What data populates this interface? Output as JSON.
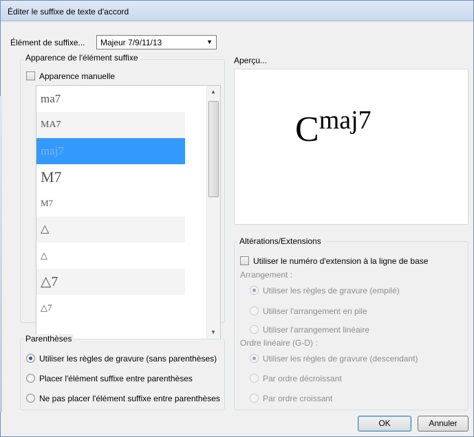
{
  "window": {
    "title": "Éditer le suffixe de texte d'accord"
  },
  "suffix_element": {
    "label": "Élément de suffixe...",
    "selected": "Majeur 7/9/11/13"
  },
  "appearance": {
    "group_title": "Apparence de l'élément suffixe",
    "manual_label": "Apparence manuelle",
    "manual_checked": false,
    "items": [
      "ma7",
      "MA7",
      "maj7",
      "M7",
      "M7",
      "△",
      "△",
      "△7",
      "△7"
    ],
    "selected_index": 2
  },
  "preview": {
    "title": "Aperçu...",
    "root": "C",
    "suffix": "maj7"
  },
  "parentheses": {
    "group_title": "Parenthèses",
    "options": [
      "Utiliser les règles de gravure (sans parenthèses)",
      "Placer l'élément suffixe entre parenthèses",
      "Ne pas placer l'élément suffixe entre parenthèses"
    ],
    "selected_index": 0
  },
  "alterations": {
    "group_title": "Altérations/Extensions",
    "baseline_label": "Utiliser le numéro d'extension à la ligne de base",
    "baseline_checked": false,
    "arrangement_label": "Arrangement :",
    "arrangement_options": [
      "Utiliser les règles de gravure (empilé)",
      "Utiliser l'arrangement en pile",
      "Utiliser l'arrangement linéaire"
    ],
    "arrangement_selected_index": 0,
    "linear_order_label": "Ordre linéaire (G-D) :",
    "linear_order_options": [
      "Utiliser les règles de gravure (descendant)",
      "Par ordre décroissant",
      "Par ordre croissant"
    ],
    "linear_order_selected_index": 0
  },
  "buttons": {
    "ok": "OK",
    "cancel": "Annuler"
  }
}
